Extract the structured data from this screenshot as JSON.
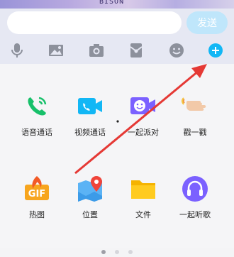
{
  "banner": {
    "text": "BISON"
  },
  "input": {
    "placeholder": "",
    "value": ""
  },
  "send_label": "发送",
  "toolbar_icons": [
    "microphone-icon",
    "image-icon",
    "camera-icon",
    "red-packet-icon",
    "emoji-icon",
    "plus-icon"
  ],
  "tiles": [
    {
      "label": "语音通话",
      "icon": "phone-call-icon"
    },
    {
      "label": "视频通话",
      "icon": "video-call-icon"
    },
    {
      "label": "一起派对",
      "icon": "party-icon"
    },
    {
      "label": "戳一戳",
      "icon": "poke-icon"
    },
    {
      "label": "热图",
      "icon": "gif-icon"
    },
    {
      "label": "位置",
      "icon": "location-icon"
    },
    {
      "label": "文件",
      "icon": "folder-icon"
    },
    {
      "label": "一起听歌",
      "icon": "headphones-icon"
    }
  ],
  "pagination": {
    "pages": 3,
    "current": 1
  },
  "colors": {
    "accent": "#12b7f5",
    "arrow": "#e53935",
    "send_bg": "#bfe6fb"
  }
}
